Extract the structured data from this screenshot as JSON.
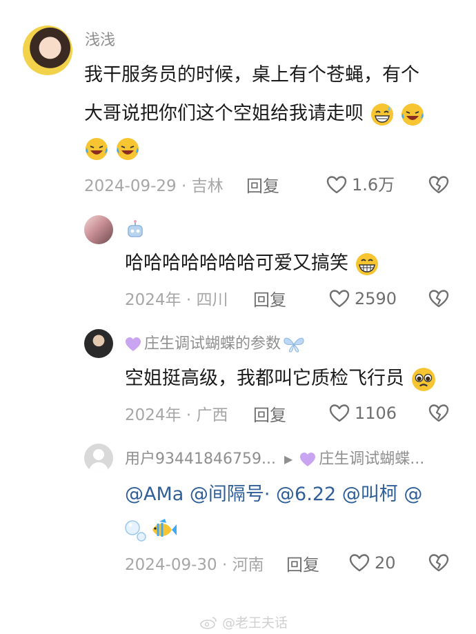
{
  "comments": [
    {
      "name": "浅浅",
      "text_line1": "我干服务员的时候，桌上有个苍蝇，有个",
      "text_line2": "大哥说把你们这个空姐给我请走呗",
      "meta": "2024-09-29 · 吉林",
      "reply_label": "回复",
      "likes": "1.6万"
    },
    {
      "name": "",
      "text": "哈哈哈哈哈哈哈可爱又搞笑",
      "meta": "2024年 · 四川",
      "reply_label": "回复",
      "likes": "2590"
    },
    {
      "name": "庄生调试蝴蝶的参数",
      "text": "空姐挺高级，我都叫它质检飞行员",
      "meta": "2024年 · 广西",
      "reply_label": "回复",
      "likes": "1106"
    },
    {
      "name": "用户93441846759...",
      "reply_to": "庄生调试蝴蝶...",
      "text": "@AMa @间隔号· @6.22 @叫柯 @",
      "meta": "2024-09-30 · 河南",
      "reply_label": "回复",
      "likes": "20"
    }
  ],
  "watermark": "@老王夫话",
  "icons": {
    "like": "heart-outline-icon",
    "dislike": "broken-heart-icon",
    "robot": "robot-icon",
    "heart": "purple-heart-icon",
    "butterfly": "butterfly-icon",
    "fish": "tropical-fish-icon",
    "bubbles": "bubbles-icon",
    "grin_sweat": "grin-sweat-emoji",
    "laugh_cry": "laughing-crying-emoji",
    "grin": "grinning-emoji",
    "pleading": "pleading-face-emoji"
  },
  "colors": {
    "meta": "#a6a6a6",
    "name": "#8f8f8f",
    "mention": "#3a6ea5",
    "heart_purple": "#c9a4f0"
  }
}
